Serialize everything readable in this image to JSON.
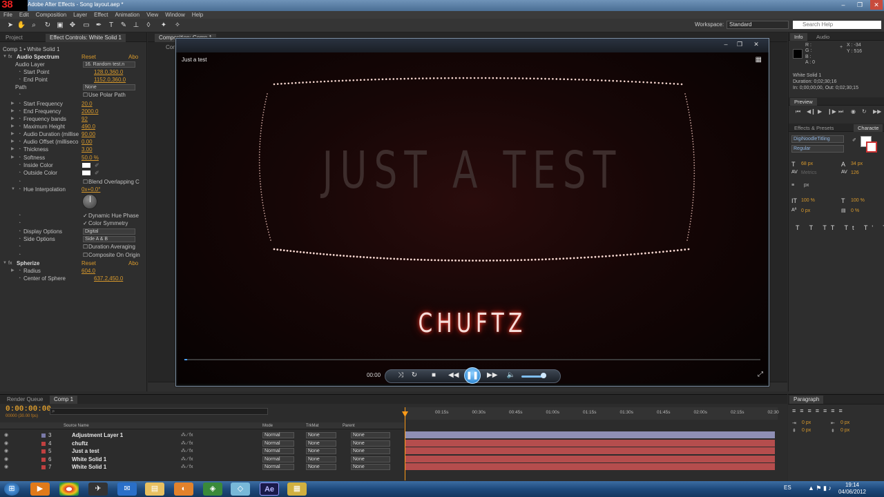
{
  "window": {
    "fps_overlay": "38",
    "title": "Adobe After Effects - Song layout.aep *",
    "controls": [
      "–",
      "❐",
      "✕"
    ]
  },
  "menu": [
    "File",
    "Edit",
    "Composition",
    "Layer",
    "Effect",
    "Animation",
    "View",
    "Window",
    "Help"
  ],
  "toolbar": {
    "workspace_label": "Workspace:",
    "workspace_value": "Standard",
    "search_placeholder": "Search Help"
  },
  "left_panel": {
    "tabs": [
      "Project",
      "Effect Controls: White Solid 1"
    ],
    "breadcrumb": "Comp 1 • White Solid 1",
    "effects": [
      {
        "name": "Audio Spectrum",
        "reset": "Reset",
        "about": "Abo"
      },
      {
        "name": "Spherize",
        "reset": "Reset",
        "about": "Abo"
      }
    ],
    "props": {
      "audio_layer": {
        "label": "Audio Layer",
        "value": "16. Random test.n"
      },
      "start_point": {
        "label": "Start Point",
        "value": "128.0,360.0"
      },
      "end_point": {
        "label": "End Point",
        "value": "1152.0,360.0"
      },
      "path": {
        "label": "Path",
        "value": "None"
      },
      "use_polar": {
        "label": "Use Polar Path"
      },
      "start_freq": {
        "label": "Start Frequency",
        "value": "20.0"
      },
      "end_freq": {
        "label": "End Frequency",
        "value": "2000.0"
      },
      "freq_bands": {
        "label": "Frequency bands",
        "value": "92"
      },
      "max_height": {
        "label": "Maximum Height",
        "value": "490.0"
      },
      "audio_duration": {
        "label": "Audio Duration (millise",
        "value": "90.00"
      },
      "audio_offset": {
        "label": "Audio Offset (milliseco",
        "value": "0.00"
      },
      "thickness": {
        "label": "Thickness",
        "value": "3.00"
      },
      "softness": {
        "label": "Softness",
        "value": "50.0 %"
      },
      "inside_color": {
        "label": "Inside Color"
      },
      "outside_color": {
        "label": "Outside Color"
      },
      "blend": {
        "label": "Blend Overlapping C"
      },
      "hue_interp": {
        "label": "Hue Interpolation",
        "value": "0x+0.0°"
      },
      "dynamic_hue": {
        "label": "Dynamic Hue Phase"
      },
      "color_sym": {
        "label": "Color Symmetry"
      },
      "display_options": {
        "label": "Display Options",
        "value": "Digital"
      },
      "side_options": {
        "label": "Side Options",
        "value": "Side A & B"
      },
      "duration_avg": {
        "label": "Duration Averaging"
      },
      "composite": {
        "label": "Composite On Origin"
      },
      "radius": {
        "label": "Radius",
        "value": "604.0"
      },
      "center": {
        "label": "Center of Sphere",
        "value": "637.2,450.0"
      }
    }
  },
  "comp_panel": {
    "tab": "Composition: Comp 1",
    "subtab": "Comp"
  },
  "player": {
    "caption": "Just a test",
    "main_text": "JUST A TEST",
    "sub_text": "CHUFTZ",
    "time": "00:00",
    "progress": 0.005,
    "volume": 0.75
  },
  "right_panel": {
    "info_tabs": [
      "Info",
      "Audio"
    ],
    "info": {
      "r": "R :",
      "g": "G :",
      "b": "B :",
      "a": "A : 0",
      "x": "X : -34",
      "y": "Y : 516"
    },
    "layer_info": [
      "White Solid 1",
      "Duration: 0;02;30;16",
      "In: 0;00;00;00, Out: 0;02;30;15"
    ],
    "preview_tab": "Preview",
    "effects_tabs": [
      "Effects & Presets",
      "Characte"
    ],
    "char": {
      "font": "DigiNoodleTitling",
      "style": "Regular",
      "size": "68 px",
      "leading": "34 px",
      "kerning": "Metrics",
      "tracking": "126",
      "stroke": "px",
      "vscale": "100 %",
      "hscale": "100 %",
      "baseline": "0 px",
      "tsume": "0 %"
    },
    "paragraph_tab": "Paragraph",
    "para_values": [
      "0 px",
      "0 px",
      "0 px",
      "0 px"
    ]
  },
  "timeline": {
    "tabs": [
      "Render Queue",
      "Comp 1"
    ],
    "timecode": "0:00:00:00",
    "fps": "00000 (30.00 fps)",
    "col_source": "Source Name",
    "col_mode": "Mode",
    "col_trkmat": "TrkMat",
    "col_parent": "Parent",
    "ticks": [
      "00:15s",
      "00:30s",
      "00:45s",
      "01:00s",
      "01:15s",
      "01:30s",
      "01:45s",
      "02:00s",
      "02:15s",
      "02:30"
    ],
    "layers": [
      {
        "num": "3",
        "name": "Adjustment Layer 1",
        "mode": "Normal",
        "trk": "None",
        "parent": "None",
        "color": "#7a7aa8",
        "bar": "#8f8fb5"
      },
      {
        "num": "4",
        "name": "chuftz",
        "mode": "Normal",
        "trk": "None",
        "parent": "None",
        "color": "#c04040",
        "bar": "#b54d4d"
      },
      {
        "num": "5",
        "name": "Just a test",
        "mode": "Normal",
        "trk": "None",
        "parent": "None",
        "color": "#c04040",
        "bar": "#b54d4d"
      },
      {
        "num": "6",
        "name": "White Solid 1",
        "mode": "Normal",
        "trk": "None",
        "parent": "None",
        "color": "#c04040",
        "bar": "#b54d4d"
      },
      {
        "num": "7",
        "name": "White Solid 1",
        "mode": "Normal",
        "trk": "None",
        "parent": "None",
        "color": "#c04040",
        "bar": "#b54d4d"
      }
    ]
  },
  "taskbar": {
    "apps": [
      "start-orb",
      "media-player",
      "chrome",
      "app-bird",
      "outlook",
      "explorer",
      "app-fox",
      "app-green",
      "app-shape",
      "after-effects",
      "app-folder"
    ],
    "ae_label": "Ae",
    "lang": "ES",
    "time": "19:14",
    "date": "04/06/2012"
  },
  "colors": {
    "accent": "#d99a2c",
    "glow": "#ff3a2a"
  }
}
